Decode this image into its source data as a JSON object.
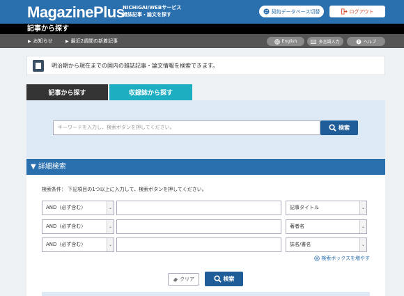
{
  "header": {
    "logo": "MagazinePlus",
    "sub_line1": "NICHIGAI/WEBサービス",
    "sub_line2": "雑誌記事・論文を探す",
    "contract_switch_label": "契約データベース切替",
    "logout_label": "ログアウト"
  },
  "title_bar": {
    "title": "記事から探す"
  },
  "nav": {
    "news_label": "お知らせ",
    "recent_label": "最近2週間の新着記事",
    "english_label": "English",
    "multilang_label": "多言語入力",
    "help_label": "ヘルプ"
  },
  "info": {
    "text": "明治期から現在までの国内の雑誌記事・論文情報を検索できます。"
  },
  "tabs": {
    "article": "記事から探す",
    "journal": "収録誌から探す"
  },
  "search": {
    "placeholder": "キーワードを入力し、検索ボタンを押してください。",
    "button_label": "検索"
  },
  "advanced": {
    "header": "▼ 詳細検索",
    "instruction": "検索条件： 下記項目の1つ以上に入力して、検索ボタンを押してください。",
    "rows": [
      {
        "operator": "AND（必ず含む）",
        "field": "記事タイトル"
      },
      {
        "operator": "AND（必ず含む）",
        "field": "著者名"
      },
      {
        "operator": "AND（必ず含む）",
        "field": "誌名/書名"
      }
    ],
    "more_link": "検索ボックスを増やす",
    "clear_label": "クリア",
    "search_label": "検索"
  },
  "colors": {
    "brand_blue": "#2a6fae",
    "tab_active": "#333333",
    "tab_inactive": "#1eaec1",
    "button_blue": "#1f5d98",
    "logout_red": "#d94a2a"
  }
}
